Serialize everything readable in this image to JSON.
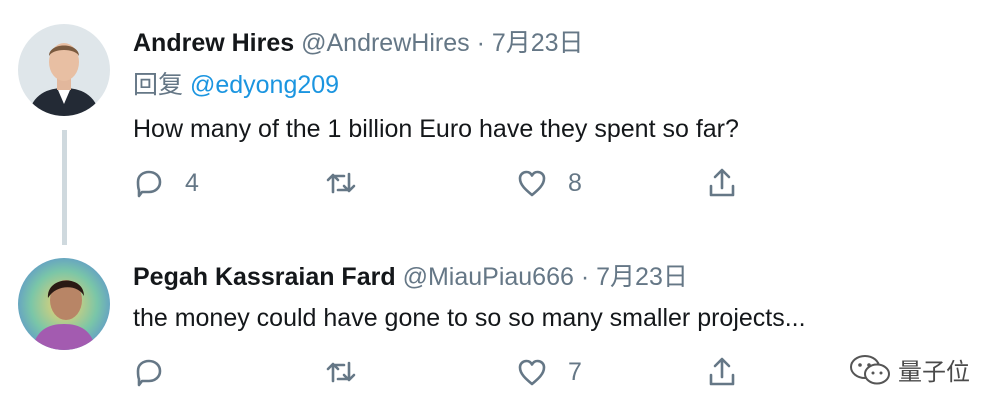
{
  "tweets": [
    {
      "name": "Andrew Hires",
      "handle": "@AndrewHires",
      "separator": "·",
      "date": "7月23日",
      "reply_prefix": "回复",
      "reply_to": "@edyong209",
      "text": "How many of the 1 billion Euro have they spent so far?",
      "reply_count": "4",
      "like_count": "8"
    },
    {
      "name": "Pegah Kassraian Fard",
      "handle": "@MiauPiau666",
      "separator": "·",
      "date": "7月23日",
      "text": "the money could have gone to so so many smaller projects...",
      "like_count": "7"
    }
  ],
  "watermark": {
    "text": "量子位"
  },
  "colors": {
    "name": "#14171a",
    "secondary": "#657786",
    "mention": "#1b95e0",
    "thread_line": "#cfd9de"
  },
  "icons": [
    "reply-icon",
    "retweet-icon",
    "like-icon",
    "share-icon",
    "wechat-icon"
  ]
}
